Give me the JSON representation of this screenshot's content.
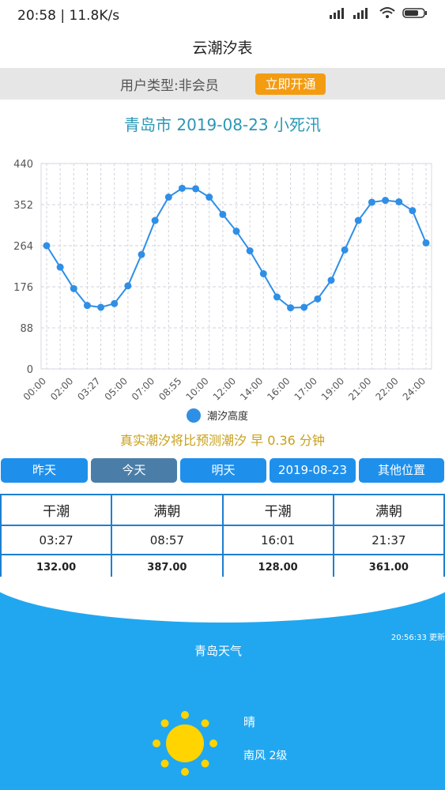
{
  "status_bar": {
    "time_speed": "20:58 | 11.8K/s"
  },
  "header": {
    "title": "云潮汐表"
  },
  "user_bar": {
    "user_type": "用户类型:非会员",
    "open_button": "立即开通"
  },
  "chart_data": {
    "type": "line",
    "title": "青岛市 2019-08-23 小死汛",
    "x_tick_labels": [
      "00:00",
      "02:00",
      "03:27",
      "05:00",
      "07:00",
      "08:55",
      "10:00",
      "12:00",
      "14:00",
      "16:00",
      "17:00",
      "19:00",
      "21:00",
      "22:00",
      "24:00"
    ],
    "y_ticks": [
      0,
      88,
      176,
      264,
      352,
      440
    ],
    "ylim": [
      0,
      440
    ],
    "grid": true,
    "legend_position": "bottom-center",
    "series": [
      {
        "name": "潮汐高度",
        "color": "#2f8fe6",
        "values": [
          264,
          218,
          172,
          136,
          132,
          140,
          178,
          245,
          318,
          368,
          387,
          386,
          368,
          331,
          295,
          253,
          204,
          154,
          131,
          132,
          150,
          190,
          255,
          318,
          357,
          361,
          358,
          339,
          270
        ]
      }
    ]
  },
  "compare_text": "真实潮汐将比预测潮汐 早 0.36 分钟",
  "tabs": {
    "yesterday": "昨天",
    "today": "今天",
    "tomorrow": "明天",
    "date": "2019-08-23",
    "other": "其他位置"
  },
  "tide_table": {
    "headers": [
      "干潮",
      "满朝",
      "干潮",
      "满朝"
    ],
    "times": [
      "03:27",
      "08:57",
      "16:01",
      "21:37"
    ],
    "heights": [
      "132.00",
      "387.00",
      "128.00",
      "361.00"
    ]
  },
  "weather": {
    "update_time": "20:56:33 更新",
    "city": "青岛天气",
    "condition": "晴",
    "wind": "南风 2级"
  }
}
